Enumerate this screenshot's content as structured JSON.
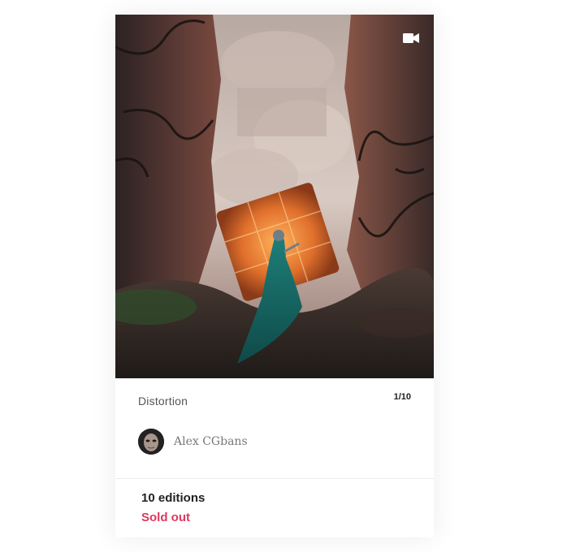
{
  "card": {
    "title": "Distortion",
    "edition_index": "1/10",
    "media_icon": "video-camera-icon",
    "creator": {
      "name": "Alex CGbans",
      "avatar_icon": "avatar"
    },
    "editions_label": "10 editions",
    "status_label": "Sold out"
  },
  "colors": {
    "status_red": "#e0375c",
    "text_dark": "#222222",
    "text_muted": "#555555"
  }
}
